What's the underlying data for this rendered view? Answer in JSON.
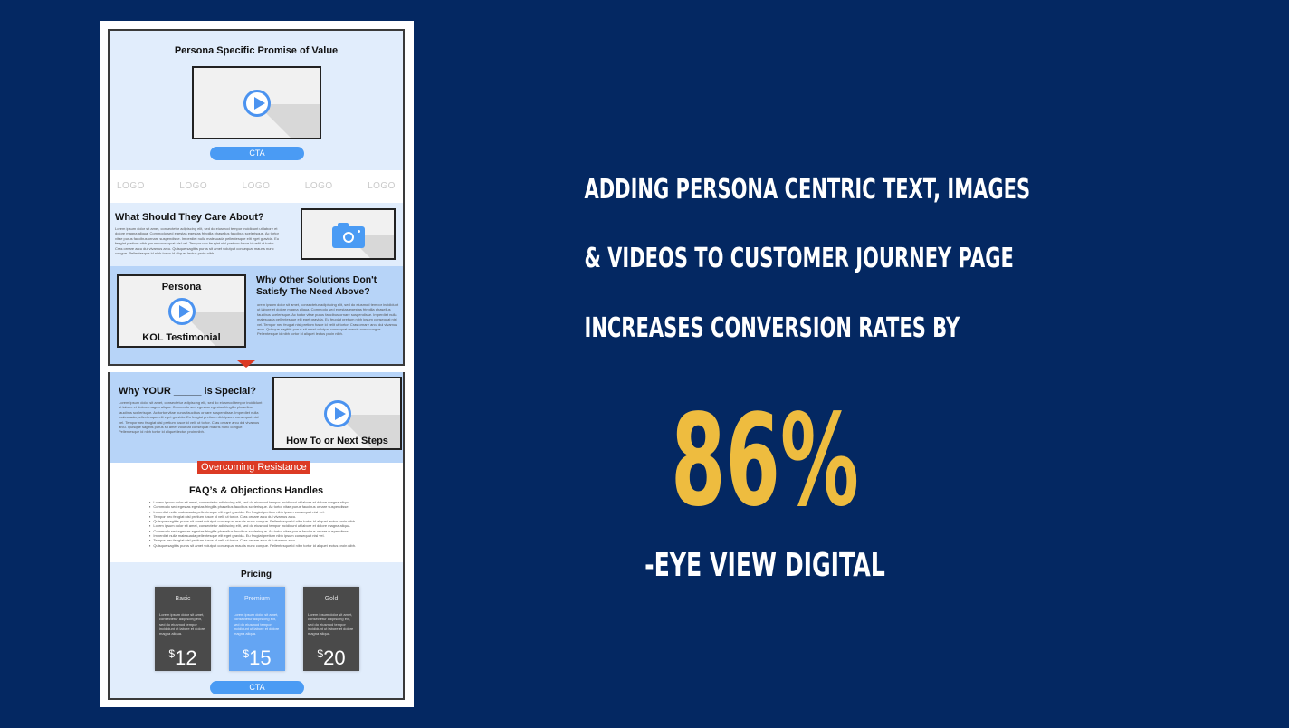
{
  "colors": {
    "background": "#042862",
    "accent_yellow": "#eebc3f",
    "headline_text": "#ffffff",
    "wire_light_blue": "#e1edfc",
    "wire_mid_blue": "#b7d4f8",
    "wire_cta_blue": "#4a9bf4",
    "wire_red": "#dc3a24",
    "price_dark": "#4a4a4a",
    "price_premium": "#64a5f3"
  },
  "wireframe": {
    "hero": {
      "title": "Persona Specific Promise of Value",
      "video_icon": "play-icon",
      "cta_label": "CTA"
    },
    "logos": [
      "LOGO",
      "LOGO",
      "LOGO",
      "LOGO",
      "LOGO"
    ],
    "care_section": {
      "heading": "What Should They Care About?",
      "body": "Lorem ipsum dolor sit amet, consectetur adipiscing elit, sed do eiusmod tempor incididunt ut labore et dolore magna aliqua. Commodo sed egestas egestas fringilla phasellus faucibus scelerisque. Ac tortor vitae purus faucibus ornare suspendisse. Imperdiet nulla malesuada pellentesque elit eget gravida. Eu feugiat pretium nibh ipsum consequat nisl vel. Tempor nec feugiat nisl pretium fusce id velit ut tortor. Cras ornare arcu dui vivamus arcu. Quisque sagittis purus sit amet volutpat consequat mauris nunc congue. Pellentesque id nibh tortor id aliquet lectus proin nibh.",
      "image_icon": "camera-icon"
    },
    "other_solutions": {
      "video_top_caption": "Persona",
      "video_bottom_caption": "KOL Testimonial",
      "heading_line1": "Why Other Solutions Don't",
      "heading_line2": "Satisfy The Need Above?",
      "body": "orem ipsum dolor sit amet, consectetur adipiscing elit, sed do eiusmod tempor incididunt ut labore et dolore magna aliqua. Commodo sed egestas egestas fringilla phasellus faucibus scelerisque. Ac tortor vitae purus faucibus ornare suspendisse. Imperdiet nulla malesuada pellentesque elit eget gravida. Eu feugiat pretium nibh ipsum consequat nisl vel. Tempor nec feugiat nisl pretium fusce id velit ut tortor. Cras ornare arcu dui vivamus arcu. Quisque sagittis purus sit amet volutpat consequat mauris nunc congue. Pellentesque id nibh tortor id aliquet lectus proin nibh."
    },
    "special": {
      "heading": "Why YOUR _____ is Special?",
      "body": "Lorem ipsum dolor sit amet, consectetur adipiscing elit, sed do eiusmod tempor incididunt ut labore et dolore magna aliqua. Commodo sed egestas egestas fringilla phasellus faucibus scelerisque. Ac tortor vitae purus faucibus ornare suspendisse. Imperdiet nulla malesuada pellentesque elit eget gravida. Eu feugiat pretium nibh ipsum consequat nisl vel. Tempor nec feugiat nisl pretium fusce id velit ut tortor. Cras ornare arcu dui vivamus arcu. Quisque sagittis purus sit amet volutpat consequat mauris nunc congue. Pellentesque id nibh tortor id aliquet lectus proin nibh.",
      "video_caption": "How To or Next Steps"
    },
    "resistance_badge": "Overcoming Resistance",
    "faq": {
      "heading": "FAQ’s & Objections Handles",
      "items": [
        "Lorem ipsum dolor sit amet, consectetur adipiscing elit, sed do eiusmod tempor incididunt ut labore et dolore magna aliqua.",
        "Commodo sed egestas egestas fringilla phasellus faucibus scelerisque. Ac tortor vitae purus faucibus ornare suspendisse.",
        "Imperdiet nulla malesuada pellentesque elit eget gravida. Eu feugiat pretium nibh ipsum consequat nisl vel.",
        "Tempor nec feugiat nisl pretium fusce id velit ut tortor. Cras ornare arcu dui vivamus arcu.",
        "Quisque sagittis purus sit amet volutpat consequat mauris nunc congue. Pellentesque id nibh tortor id aliquet lectus proin nibh.",
        "Lorem ipsum dolor sit amet, consectetur adipiscing elit, sed do eiusmod tempor incididunt ut labore et dolore magna aliqua.",
        "Commodo sed egestas egestas fringilla phasellus faucibus scelerisque. Ac tortor vitae purus faucibus ornare suspendisse.",
        "Imperdiet nulla malesuada pellentesque elit eget gravida. Eu feugiat pretium nibh ipsum consequat nisl vel.",
        "Tempor nec feugiat nisl pretium fusce id velit ut tortor. Cras ornare arcu dui vivamus arcu.",
        "Quisque sagittis purus sit amet volutpat consequat mauris nunc congue. Pellentesque id nibh tortor id aliquet lectus proin nibh."
      ]
    },
    "pricing": {
      "heading": "Pricing",
      "plans": [
        {
          "name": "Basic",
          "description": "Lorem ipsum dolor sit amet, consectetur adipiscing elit, sed do eiusmod tempor incididunt ut labore et dolore magna aliqua.",
          "currency": "$",
          "amount": "12"
        },
        {
          "name": "Premium",
          "description": "Lorem ipsum dolor sit amet, consectetur adipiscing elit, sed do eiusmod tempor incididunt ut labore et dolore magna aliqua.",
          "currency": "$",
          "amount": "15"
        },
        {
          "name": "Gold",
          "description": "Lorem ipsum dolor sit amet, consectetur adipiscing elit, sed do eiusmod tempor incididunt ut labore et dolore magna aliqua.",
          "currency": "$",
          "amount": "20"
        }
      ],
      "cta_label": "CTA"
    }
  },
  "headline": {
    "line1": "ADDING PERSONA CENTRIC TEXT, IMAGES",
    "line2": "& VIDEOS TO CUSTOMER JOURNEY PAGE",
    "line3": "INCREASES CONVERSION RATES BY",
    "stat": "86%",
    "source": "-EYE VIEW DIGITAL"
  }
}
